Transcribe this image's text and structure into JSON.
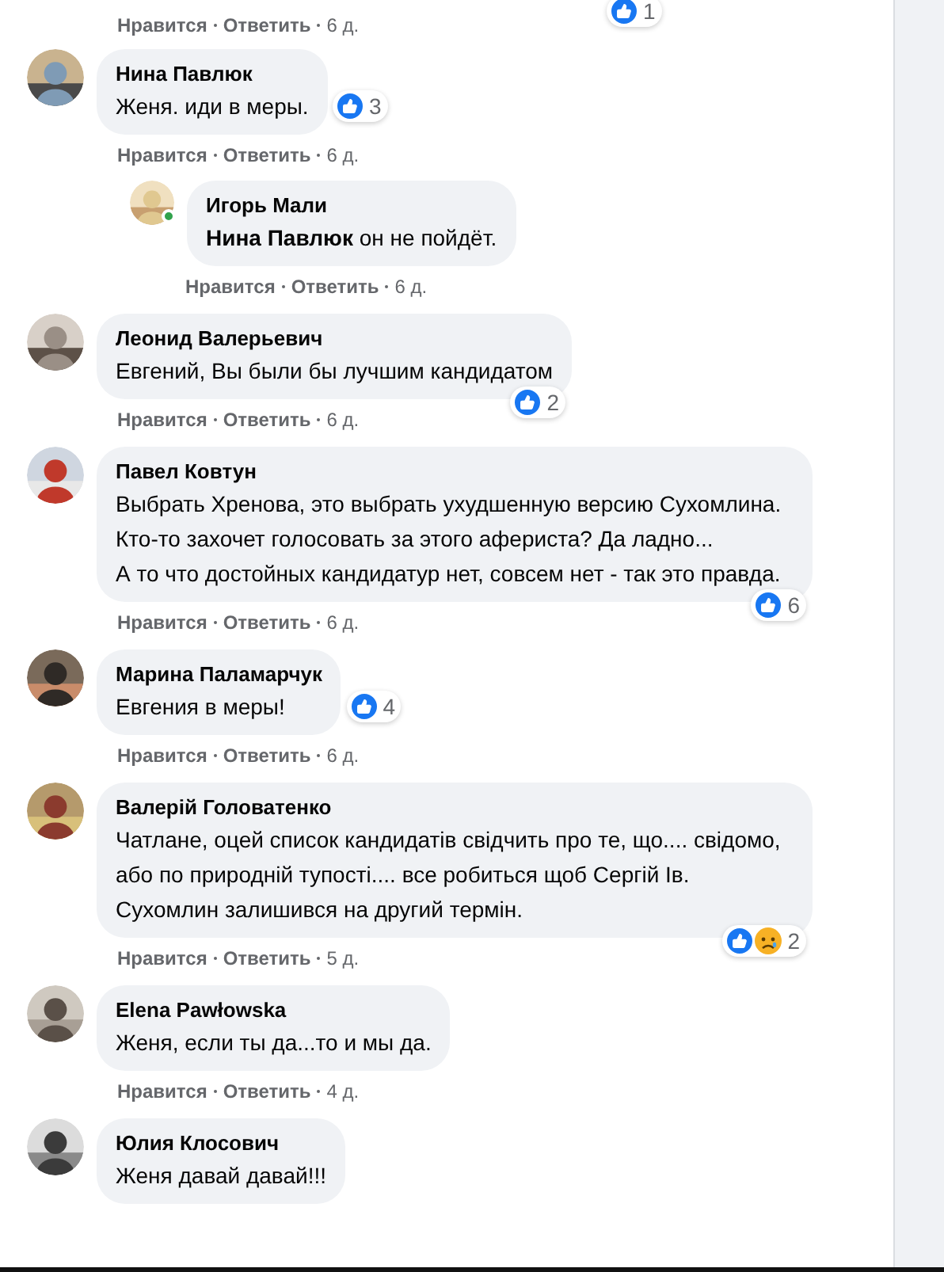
{
  "top_actions": {
    "like": "Нравится",
    "reply": "Ответить",
    "time": "6 д.",
    "reactions": {
      "count": "1",
      "emoji": [
        {
          "kind": "like"
        }
      ]
    }
  },
  "comments": [
    {
      "author": "Нина Павлюк",
      "text": "Женя. иди в меры.",
      "reactions": {
        "kind": "beside",
        "emoji": [
          {
            "kind": "like"
          }
        ],
        "count": "3"
      },
      "like": "Нравится",
      "reply": "Ответить",
      "time": "6 д.",
      "replies": [
        {
          "author": "Игорь Мали",
          "online": true,
          "text": "**Нина Павлюк** он не пойдёт.",
          "like": "Нравится",
          "reply": "Ответить",
          "time": "6 д."
        }
      ]
    },
    {
      "author": "Леонид Валерьевич",
      "text": "Евгений, Вы были бы лучшим кандидатом",
      "reactions": {
        "kind": "below",
        "emoji": [
          {
            "kind": "like"
          }
        ],
        "count": "2"
      },
      "like": "Нравится",
      "reply": "Ответить",
      "time": "6 д."
    },
    {
      "author": "Павел Ковтун",
      "text": "Выбрать Хренова, это выбрать ухудшенную версию Сухомлина. Кто-то захочет голосовать за этого афериста? Да ладно...\nА то что достойных кандидатур нет, совсем нет - так это правда.",
      "reactions": {
        "kind": "below",
        "emoji": [
          {
            "kind": "like"
          }
        ],
        "count": "6"
      },
      "like": "Нравится",
      "reply": "Ответить",
      "time": "6 д."
    },
    {
      "author": "Марина Паламарчук",
      "text": "Евгения в меры!",
      "reactions": {
        "kind": "beside",
        "emoji": [
          {
            "kind": "like"
          }
        ],
        "count": "4"
      },
      "like": "Нравится",
      "reply": "Ответить",
      "time": "6 д."
    },
    {
      "author": "Валерій Головатенко",
      "text": "Чатлане, оцей список кандидатів свідчить про те, що.... свідомо, або по природній тупості.... все робиться щоб Сергій Ів. Сухомлин залишився на другий термін.",
      "reactions": {
        "kind": "below",
        "emoji": [
          {
            "kind": "like"
          },
          {
            "kind": "sad"
          }
        ],
        "count": "2"
      },
      "like": "Нравится",
      "reply": "Ответить",
      "time": "5 д."
    },
    {
      "author": "Elena Pawłowska",
      "text": "Женя, если ты да...то и мы да.",
      "like": "Нравится",
      "reply": "Ответить",
      "time": "4 д."
    },
    {
      "author": "Юлия Клосович",
      "text": "Женя давай давай!!!"
    }
  ]
}
